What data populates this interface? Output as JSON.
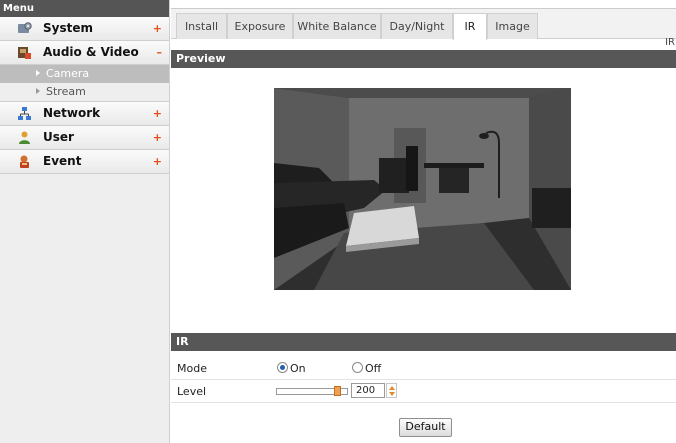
{
  "sidebar": {
    "title": "Menu",
    "items": [
      {
        "label": "System",
        "sign": "+",
        "icon": "system-icon"
      },
      {
        "label": "Audio & Video",
        "sign": "–",
        "icon": "audio-video-icon"
      },
      {
        "label": "Network",
        "sign": "+",
        "icon": "network-icon"
      },
      {
        "label": "User",
        "sign": "+",
        "icon": "user-icon"
      },
      {
        "label": "Event",
        "sign": "+",
        "icon": "event-icon"
      }
    ],
    "subitems": [
      {
        "label": "Camera",
        "active": true
      },
      {
        "label": "Stream",
        "active": false
      }
    ]
  },
  "tabs": [
    {
      "label": "Install"
    },
    {
      "label": "Exposure"
    },
    {
      "label": "White Balance"
    },
    {
      "label": "Day/Night"
    },
    {
      "label": "IR",
      "active": true
    },
    {
      "label": "Image"
    }
  ],
  "corner_label": "IR",
  "preview": {
    "title": "Preview",
    "image": "camera-feed"
  },
  "ir_section": {
    "title": "IR",
    "mode": {
      "label": "Mode",
      "options": [
        "On",
        "Off"
      ],
      "selected": "On"
    },
    "level": {
      "label": "Level",
      "value": "200",
      "slider_fraction": 0.9
    }
  },
  "default_button": "Default",
  "colors": {
    "section_bar": "#575757",
    "accent": "#e0501c",
    "slider_handle": "#f0a050"
  }
}
